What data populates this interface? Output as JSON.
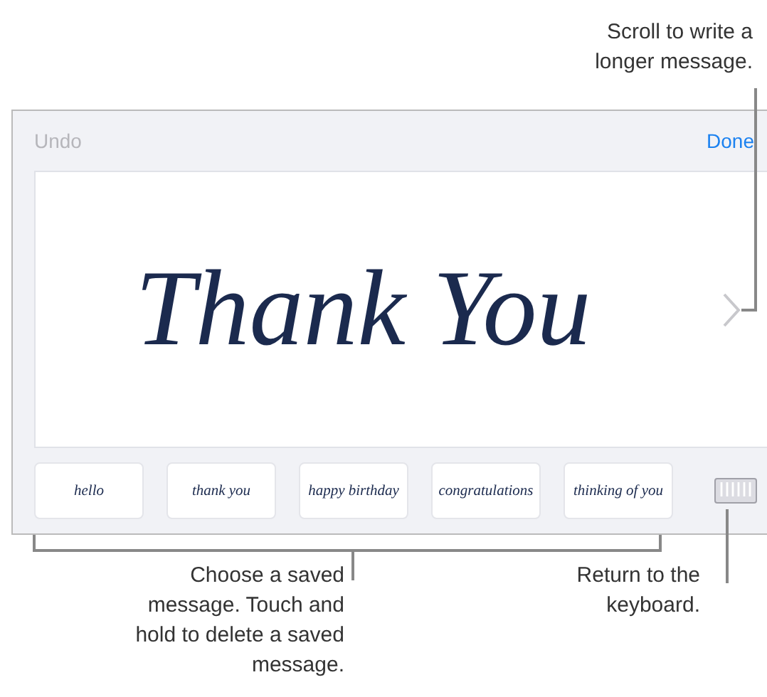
{
  "callouts": {
    "scroll": "Scroll to write a longer message.",
    "saved": "Choose a saved message. Touch and hold to delete a saved message.",
    "keyboard": "Return to the keyboard."
  },
  "toolbar": {
    "undo": {
      "label": "Undo",
      "disabled": true
    },
    "done": {
      "label": "Done",
      "disabled": false
    }
  },
  "canvas": {
    "handwriting": "Thank You"
  },
  "saved_messages": [
    "hello",
    "thank you",
    "happy birthday",
    "congratulations",
    "thinking of you"
  ]
}
